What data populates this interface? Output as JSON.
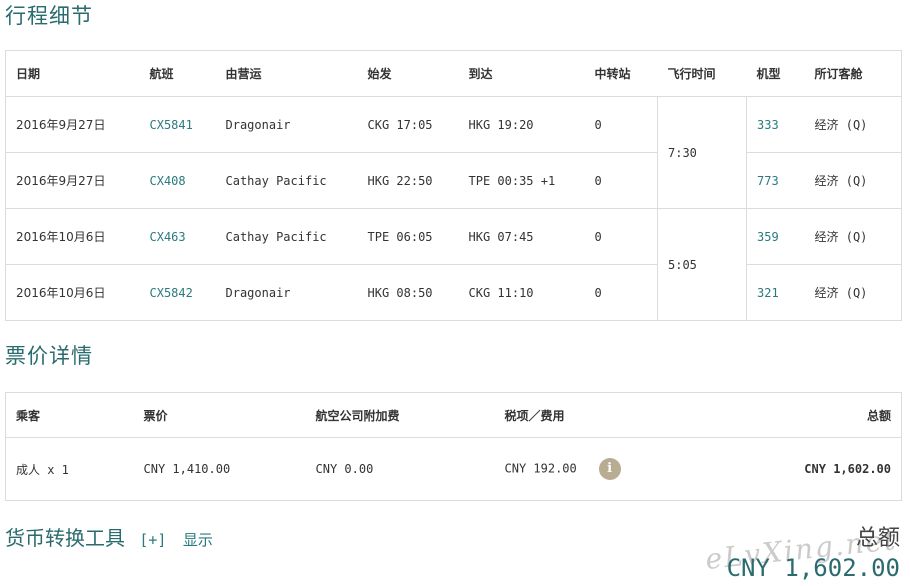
{
  "itinerary": {
    "title": "行程细节",
    "headers": [
      "日期",
      "航班",
      "由营运",
      "始发",
      "到达",
      "中转站",
      "飞行时间",
      "机型",
      "所订客舱"
    ],
    "rows": [
      {
        "date": "2016年9月27日",
        "flight": "CX5841",
        "operator": "Dragonair",
        "depart": "CKG 17:05",
        "arrive": "HKG 19:20",
        "stops": "0",
        "aircraft": "333",
        "cabin": "经济 (Q)"
      },
      {
        "date": "2016年9月27日",
        "flight": "CX408",
        "operator": "Cathay Pacific",
        "depart": "HKG 22:50",
        "arrive": "TPE 00:35 +1",
        "stops": "0",
        "aircraft": "773",
        "cabin": "经济 (Q)"
      },
      {
        "date": "2016年10月6日",
        "flight": "CX463",
        "operator": "Cathay Pacific",
        "depart": "TPE 06:05",
        "arrive": "HKG 07:45",
        "stops": "0",
        "aircraft": "359",
        "cabin": "经济 (Q)"
      },
      {
        "date": "2016年10月6日",
        "flight": "CX5842",
        "operator": "Dragonair",
        "depart": "HKG 08:50",
        "arrive": "CKG 11:10",
        "stops": "0",
        "aircraft": "321",
        "cabin": "经济 (Q)"
      }
    ],
    "durations": [
      "7:30",
      "5:05"
    ]
  },
  "fare": {
    "title": "票价详情",
    "headers": {
      "passenger": "乘客",
      "fare": "票价",
      "surcharge": "航空公司附加费",
      "taxes": "税项／费用",
      "total": "总额"
    },
    "row": {
      "passenger": "成人 x 1",
      "fare": "CNY 1,410.00",
      "surcharge": "CNY 0.00",
      "taxes": "CNY 192.00",
      "total": "CNY 1,602.00"
    },
    "info_icon": "info-icon"
  },
  "converter": {
    "title": "货币转换工具",
    "toggle": "[+]",
    "show": "显示"
  },
  "summary": {
    "total_label": "总额",
    "total_value": "CNY 1,602.00"
  },
  "watermark": "eLvXing.net",
  "colors": {
    "accent": "#2a6b6e",
    "link": "#2a7a7f",
    "border": "#dcdcdc",
    "info_icon_bg": "#b8ad92"
  }
}
